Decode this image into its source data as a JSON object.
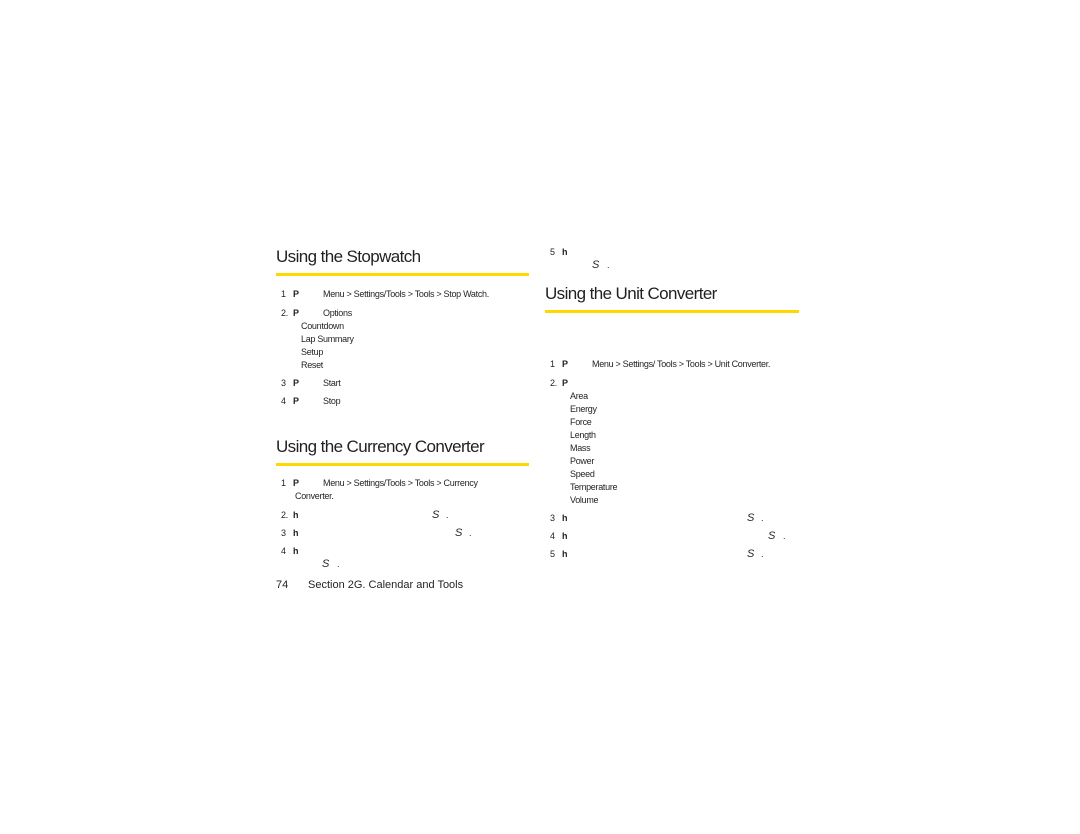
{
  "stopwatch": {
    "title": "Using the Stopwatch",
    "step1": {
      "num": "1",
      "text": "Menu > Settings/Tools > Tools > Stop Watch."
    },
    "step2": {
      "num": "2.",
      "text": "Options",
      "options": [
        "Countdown",
        "Lap Summary",
        "Setup",
        "Reset"
      ]
    },
    "step3": {
      "num": "3",
      "text": "Start"
    },
    "step4": {
      "num": "4",
      "text": "Stop"
    }
  },
  "currency": {
    "title": "Using the Currency Converter",
    "step1": {
      "num": "1",
      "text": "Menu > Settings/Tools > Tools > Currency",
      "text2": "Converter."
    },
    "step2": {
      "num": "2.",
      "key": "S",
      "dot": "."
    },
    "step3": {
      "num": "3",
      "key": "S",
      "dot": "."
    },
    "step4": {
      "num": "4",
      "key": "S",
      "dot": "."
    },
    "step5": {
      "num": "5",
      "key": "S",
      "dot": "."
    }
  },
  "unit": {
    "title": "Using the Unit Converter",
    "step1": {
      "num": "1",
      "text": "Menu > Settings/ Tools > Tools > Unit Converter."
    },
    "step2": {
      "num": "2.",
      "options": [
        "Area",
        "Energy",
        "Force",
        "Length",
        "Mass",
        "Power",
        "Speed",
        "Temperature",
        "Volume"
      ]
    },
    "step3": {
      "num": "3",
      "key": "S",
      "dot": "."
    },
    "step4": {
      "num": "4",
      "key": "S",
      "dot": "."
    },
    "step5": {
      "num": "5",
      "key": "S",
      "dot": "."
    }
  },
  "glyphs": {
    "press": "P",
    "highlight": "h"
  },
  "footer": {
    "page": "74",
    "section": "Section 2G. Calendar and Tools"
  },
  "colors": {
    "rule": "#ffd800",
    "text": "#231f20"
  }
}
